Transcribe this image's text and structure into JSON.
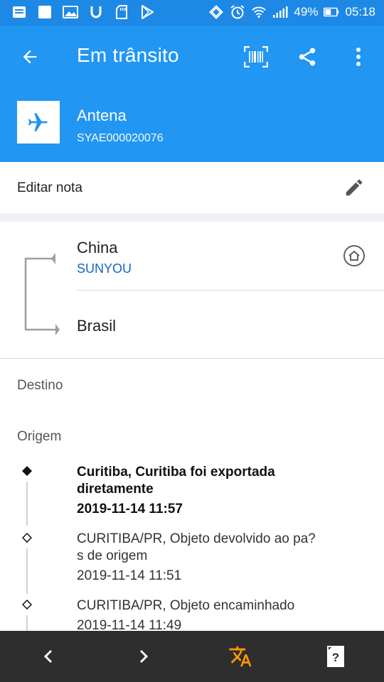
{
  "status_bar": {
    "battery_percent": "49%",
    "time": "05:18",
    "left_icons": [
      "notes-icon",
      "white-square-icon",
      "gallery-icon",
      "u-app-icon",
      "sd-card-icon",
      "play-store-icon"
    ],
    "right_icons": [
      "rotate-icon",
      "alarm-icon",
      "wifi-icon",
      "signal-icon",
      "battery-icon"
    ]
  },
  "app_bar": {
    "title": "Em trânsito",
    "package_name": "Antena",
    "tracking_code": "SYAE000020076",
    "accent_color": "#2196f3"
  },
  "note": {
    "label": "Editar nota"
  },
  "route": {
    "from_country": "China",
    "carrier": "SUNYOU",
    "to_country": "Brasil"
  },
  "sections": {
    "destination_label": "Destino",
    "origin_label": "Origem"
  },
  "events": [
    {
      "description": "Curitiba, Curitiba foi exportada\ndiretamente",
      "time": "2019-11-14 11:57",
      "current": true
    },
    {
      "description": "CURITIBA/PR, Objeto devolvido ao pa?\ns de origem",
      "time": "2019-11-14 11:51",
      "current": false
    },
    {
      "description": "CURITIBA/PR, Objeto encaminhado",
      "time": "2019-11-14 11:49",
      "current": false
    }
  ],
  "bottom_nav": {
    "translate_color": "#ff9800"
  }
}
